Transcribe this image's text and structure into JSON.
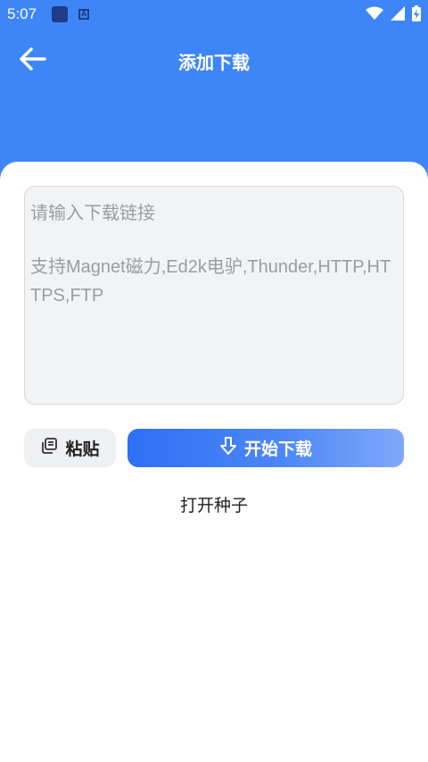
{
  "status_bar": {
    "time": "5:07"
  },
  "app_bar": {
    "title": "添加下载"
  },
  "link_input": {
    "placeholder_main": "请输入下载链接",
    "placeholder_support": "支持Magnet磁力,Ed2k电驴,Thunder,HTTP,HTTPS,FTP"
  },
  "actions": {
    "paste_label": "粘贴",
    "start_label": "开始下载",
    "open_torrent_label": "打开种子"
  },
  "colors": {
    "brand": "#3e86f7",
    "button_gradient_start": "#2f6ff5",
    "button_gradient_end": "#7fa8f9"
  }
}
